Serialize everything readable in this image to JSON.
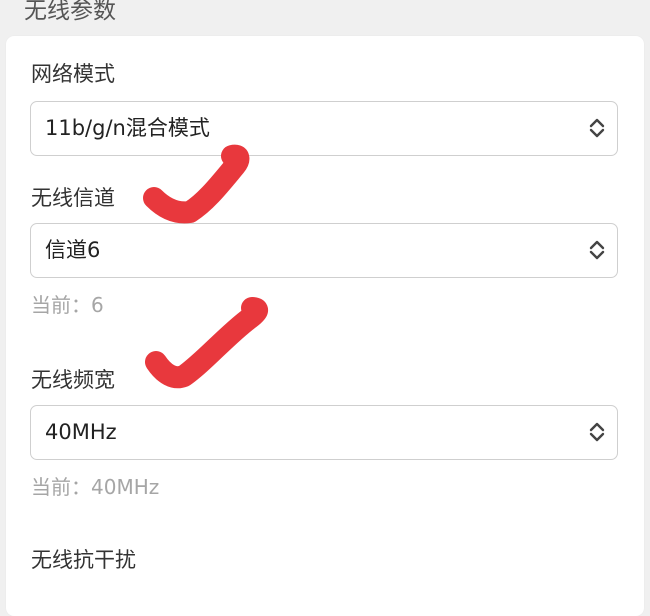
{
  "section": {
    "title": "无线参数"
  },
  "fields": {
    "network_mode": {
      "label": "网络模式",
      "value": "11b/g/n混合模式"
    },
    "channel": {
      "label": "无线信道",
      "value": "信道6",
      "current": "当前：6"
    },
    "bandwidth": {
      "label": "无线频宽",
      "value": "40MHz",
      "current": "当前：40MHz"
    },
    "anti_interference": {
      "label": "无线抗干扰"
    }
  },
  "icons": {
    "select": "chevron-up-down-icon",
    "annotation": "check-mark-icon"
  },
  "colors": {
    "page_bg": "#f0f0f0",
    "card_bg": "#ffffff",
    "border": "#cfcfcf",
    "hint_text": "#a6a6a6",
    "check_mark": "#e8383d"
  }
}
